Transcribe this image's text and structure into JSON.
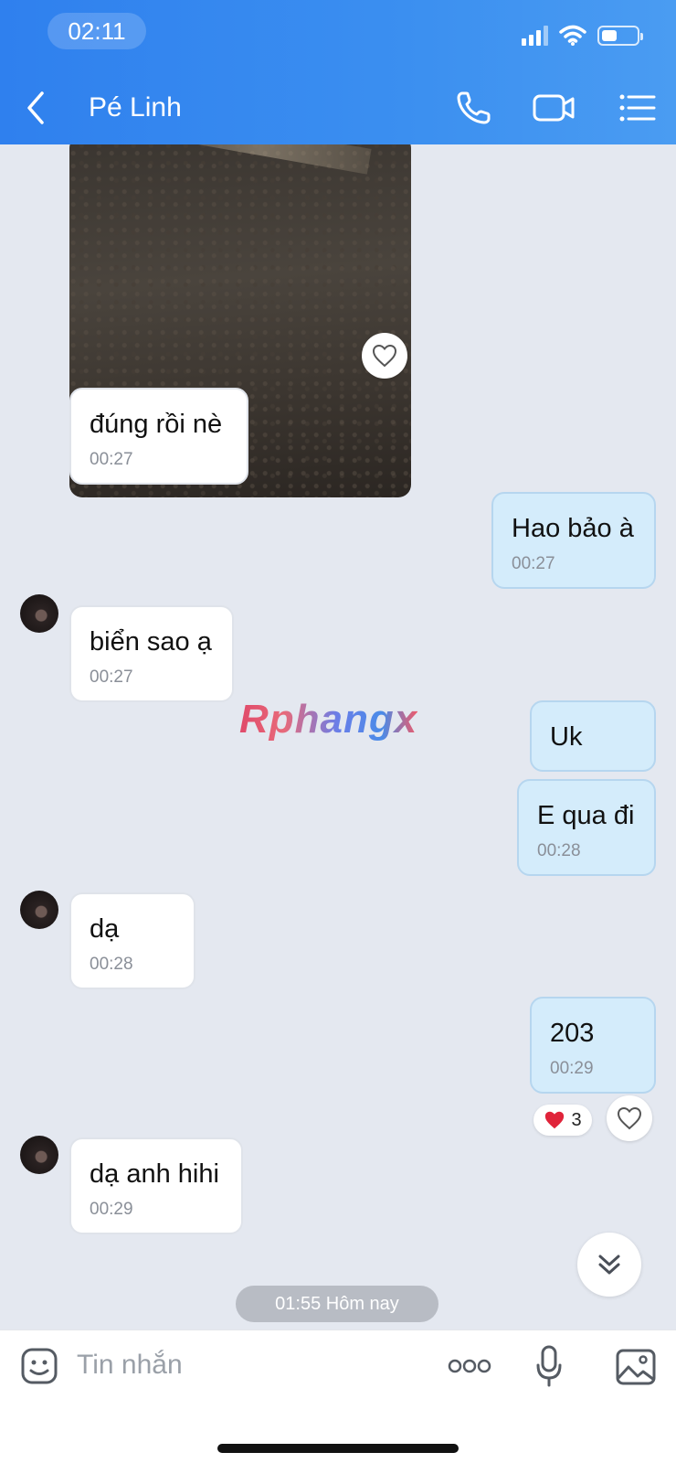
{
  "status_bar": {
    "time": "02:11"
  },
  "nav": {
    "title": "Pé Linh"
  },
  "messages": [
    {
      "dir": "in",
      "text": "đúng rồi nè",
      "time": "00:27"
    },
    {
      "dir": "out",
      "text": "Hao bảo à",
      "time": "00:27"
    },
    {
      "dir": "in",
      "text": "biển sao ạ",
      "time": "00:27"
    },
    {
      "dir": "out",
      "text": "Uk",
      "time": ""
    },
    {
      "dir": "out",
      "text": "E qua đi",
      "time": "00:28"
    },
    {
      "dir": "in",
      "text": "dạ",
      "time": "00:28"
    },
    {
      "dir": "out",
      "text": "203",
      "time": "00:29",
      "reaction_count": "3"
    },
    {
      "dir": "in",
      "text": "dạ anh hihi",
      "time": "00:29"
    }
  ],
  "watermark": "Rphangx",
  "date_separator": "01:55 Hôm nay",
  "composer": {
    "placeholder": "Tin nhắn"
  },
  "colors": {
    "header": "#3b8ff0",
    "outgoing_bubble": "#d4ecfb",
    "incoming_bubble": "#ffffff",
    "background": "#e4e8f0"
  },
  "icons": [
    "back-icon",
    "phone-icon",
    "video-icon",
    "menu-icon",
    "heart-icon",
    "chevron-down-icon",
    "sticker-icon",
    "more-icon",
    "mic-icon",
    "image-icon"
  ]
}
